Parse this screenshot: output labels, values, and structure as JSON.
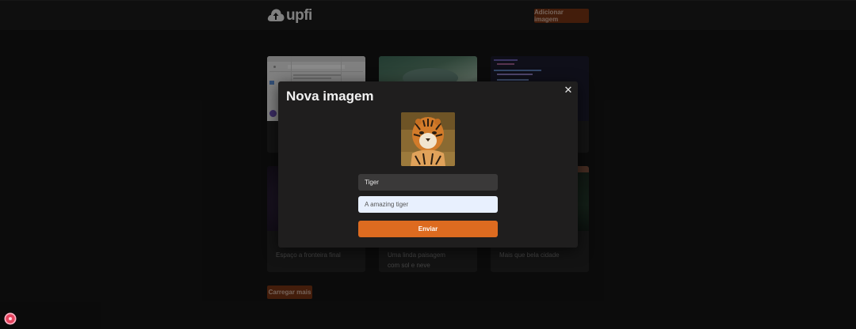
{
  "header": {
    "logo_text": "upfi",
    "add_button": "Adicionar imagem"
  },
  "cards": [
    {
      "title": "",
      "description": "Espaço a fronteira final"
    },
    {
      "title": "",
      "description": "Uma linda paisagem com sol e neve"
    },
    {
      "title": "",
      "description": "Mais que bela cidade"
    }
  ],
  "load_more": "Carregar mais",
  "modal": {
    "title": "Nova imagem",
    "close_icon": "close-icon",
    "title_field_value": "Tiger",
    "description_field_value": "A amazing tiger",
    "submit_label": "Enviar"
  },
  "colors": {
    "accent": "#dd6b20",
    "background": "#151515",
    "header": "#1d1c1c"
  }
}
